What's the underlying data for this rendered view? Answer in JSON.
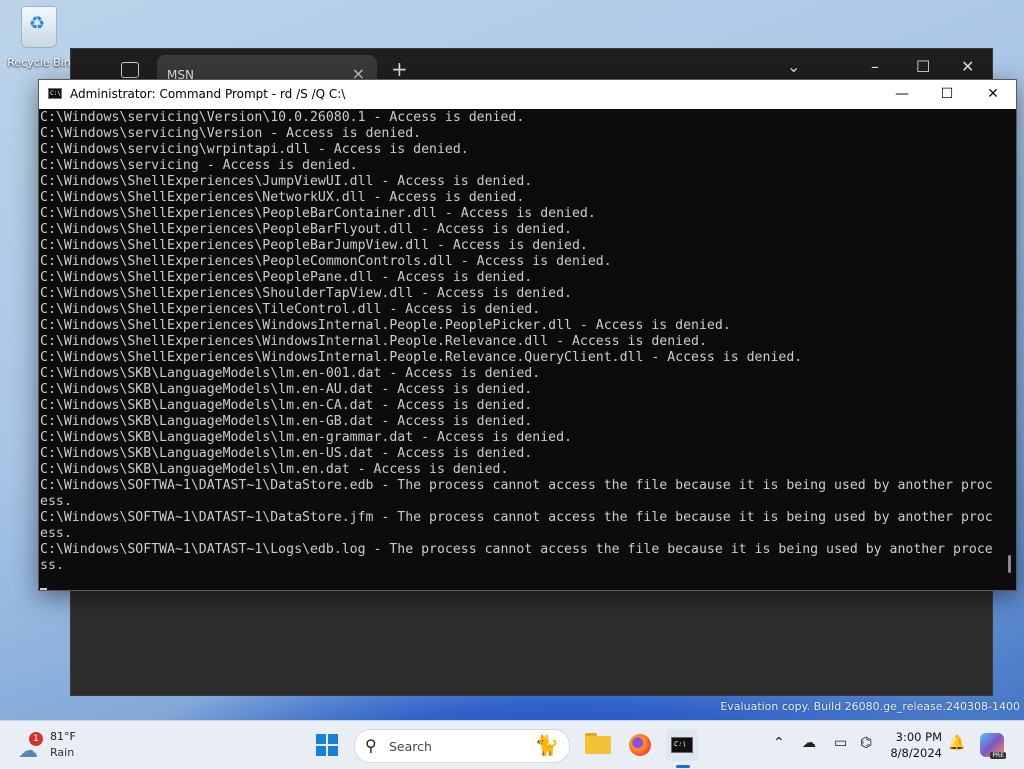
{
  "desktop": {
    "recycle_bin_label": "Recycle Bin"
  },
  "browser": {
    "tab_title": "MSN",
    "close_tab": "×",
    "new_tab": "+",
    "tab_list": "⌄",
    "minimize": "–",
    "maximize": "☐",
    "close": "✕"
  },
  "cmd": {
    "icon_text": "C:\\",
    "title": "Administrator: Command Prompt - rd  /S /Q C:\\",
    "minimize": "—",
    "maximize": "☐",
    "close": "✕",
    "lines": [
      "C:\\Windows\\servicing\\Version\\10.0.26080.1 - Access is denied.",
      "C:\\Windows\\servicing\\Version - Access is denied.",
      "C:\\Windows\\servicing\\wrpintapi.dll - Access is denied.",
      "C:\\Windows\\servicing - Access is denied.",
      "C:\\Windows\\ShellExperiences\\JumpViewUI.dll - Access is denied.",
      "C:\\Windows\\ShellExperiences\\NetworkUX.dll - Access is denied.",
      "C:\\Windows\\ShellExperiences\\PeopleBarContainer.dll - Access is denied.",
      "C:\\Windows\\ShellExperiences\\PeopleBarFlyout.dll - Access is denied.",
      "C:\\Windows\\ShellExperiences\\PeopleBarJumpView.dll - Access is denied.",
      "C:\\Windows\\ShellExperiences\\PeopleCommonControls.dll - Access is denied.",
      "C:\\Windows\\ShellExperiences\\PeoplePane.dll - Access is denied.",
      "C:\\Windows\\ShellExperiences\\ShoulderTapView.dll - Access is denied.",
      "C:\\Windows\\ShellExperiences\\TileControl.dll - Access is denied.",
      "C:\\Windows\\ShellExperiences\\WindowsInternal.People.PeoplePicker.dll - Access is denied.",
      "C:\\Windows\\ShellExperiences\\WindowsInternal.People.Relevance.dll - Access is denied.",
      "C:\\Windows\\ShellExperiences\\WindowsInternal.People.Relevance.QueryClient.dll - Access is denied.",
      "C:\\Windows\\SKB\\LanguageModels\\lm.en-001.dat - Access is denied.",
      "C:\\Windows\\SKB\\LanguageModels\\lm.en-AU.dat - Access is denied.",
      "C:\\Windows\\SKB\\LanguageModels\\lm.en-CA.dat - Access is denied.",
      "C:\\Windows\\SKB\\LanguageModels\\lm.en-GB.dat - Access is denied.",
      "C:\\Windows\\SKB\\LanguageModels\\lm.en-grammar.dat - Access is denied.",
      "C:\\Windows\\SKB\\LanguageModels\\lm.en-US.dat - Access is denied.",
      "C:\\Windows\\SKB\\LanguageModels\\lm.en.dat - Access is denied.",
      "C:\\Windows\\SOFTWA~1\\DATAST~1\\DataStore.edb - The process cannot access the file because it is being used by another proc",
      "ess.",
      "C:\\Windows\\SOFTWA~1\\DATAST~1\\DataStore.jfm - The process cannot access the file because it is being used by another proc",
      "ess.",
      "C:\\Windows\\SOFTWA~1\\DATAST~1\\Logs\\edb.log - The process cannot access the file because it is being used by another proce",
      "ss."
    ]
  },
  "watermark": {
    "line1": "Evaluation copy. Build 26080.ge_release.240308-1400"
  },
  "taskbar": {
    "weather_badge": "1",
    "weather_temp": "81°F",
    "weather_condition": "Rain",
    "search_placeholder": "Search",
    "clock_time": "3:00 PM",
    "clock_date": "8/8/2024",
    "copilot_badge": "PRE"
  }
}
